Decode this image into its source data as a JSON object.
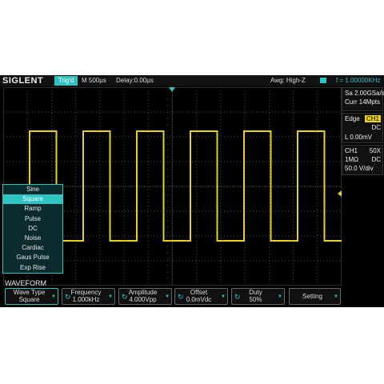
{
  "topbar": {
    "brand": "SIGLENT",
    "trig_status": "Trig'd",
    "timebase": "M 500µs",
    "delay": "Delay:0.00µs",
    "acquire": "Awg: High-Z",
    "frequency": "f = 1.00000KHz"
  },
  "side": {
    "sample_rate": "Sa 2.00GSa/s",
    "mem_depth": "Curr 14Mpts",
    "trig_type": "Edge",
    "trig_source": "CH1",
    "trig_coupling": "DC",
    "trig_level": "L  0.00mV",
    "ch_label": "CH1",
    "ch_probe": "50X",
    "ch_impedance": "1MΩ",
    "ch_coupling": "DC",
    "ch_scale": "50.0 V/div"
  },
  "waveform_menu": {
    "items": [
      "Sine",
      "Square",
      "Ramp",
      "Pulse",
      "DC",
      "Noise",
      "Cardiac",
      "Gaus Pulse",
      "Exp Rise"
    ],
    "selected_index": 1,
    "label": "WAVEFORM"
  },
  "softkeys": [
    {
      "title": "Wave Type",
      "value": "Square"
    },
    {
      "title": "Frequency",
      "value": "1.000kHz"
    },
    {
      "title": "Amplitude",
      "value": "4.000Vpp"
    },
    {
      "title": "Offset",
      "value": "0.0mVdc"
    },
    {
      "title": "Duty",
      "value": "50%"
    },
    {
      "title": "Setting",
      "value": ""
    }
  ],
  "colors": {
    "trace": "#e8d020",
    "accent": "#2fc4c4",
    "background": "#000000"
  },
  "icons": {
    "knob": "rotary-knob-icon",
    "arrow": "arrow-down-icon",
    "trigger_marker": "trigger-position-icon"
  }
}
